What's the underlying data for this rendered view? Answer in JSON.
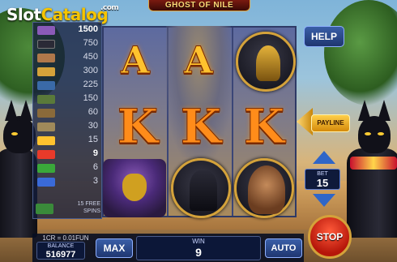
{
  "logo": {
    "part_a": "Slot",
    "part_b": "Catalog",
    "suffix": ".com"
  },
  "game_title": "GHOST OF NILE",
  "paytable": {
    "rows": [
      {
        "value": "1500",
        "icon": "pharaoh-symbol-icon",
        "color": "#8a5ab8"
      },
      {
        "value": "750",
        "icon": "anubis-symbol-icon",
        "color": "#2a2a36"
      },
      {
        "value": "450",
        "icon": "queen-symbol-icon",
        "color": "#b0784a"
      },
      {
        "value": "300",
        "icon": "cobra-symbol-icon",
        "color": "#d4a23a"
      },
      {
        "value": "225",
        "icon": "scarab-symbol-icon",
        "color": "#3a6aa8"
      },
      {
        "value": "150",
        "icon": "eye-symbol-icon",
        "color": "#5a7a3a"
      },
      {
        "value": "60",
        "icon": "ankh-symbol-icon",
        "color": "#8a6a3a"
      },
      {
        "value": "30",
        "icon": "pyramid-symbol-icon",
        "color": "#a08a5a"
      },
      {
        "value": "15",
        "icon": "letter-a-symbol-icon",
        "color": "#ffc22e"
      },
      {
        "value": "9",
        "icon": "letter-k-symbol-icon",
        "color": "#e83a2a"
      },
      {
        "value": "6",
        "icon": "letter-q-symbol-icon",
        "color": "#3aa83a"
      },
      {
        "value": "3",
        "icon": "letter-j-symbol-icon",
        "color": "#3a6ad8"
      }
    ],
    "free_spins_line1": "15 FREE",
    "free_spins_line2": "SPINS"
  },
  "reels": {
    "row1": [
      "A",
      "A"
    ],
    "row2": [
      "K",
      "K",
      "K"
    ],
    "medals": [
      "cobra",
      "anubis",
      "queen"
    ],
    "pharaoh": "pharaoh"
  },
  "controls": {
    "help_label": "HELP",
    "payline_label": "PAYLINE",
    "bet_label": "BET",
    "bet_value": "15",
    "stop_label": "STOP",
    "max_label": "MAX",
    "auto_label": "AUTO"
  },
  "status": {
    "rate": "1CR = 0.01FUN",
    "balance_label": "BALANCE",
    "balance_value": "516977",
    "win_label": "WIN",
    "win_value": "9"
  },
  "colors": {
    "accent": "#ffc22e",
    "panel": "#0c1738",
    "button": "#2f66c8",
    "stop": "#d4200e"
  }
}
